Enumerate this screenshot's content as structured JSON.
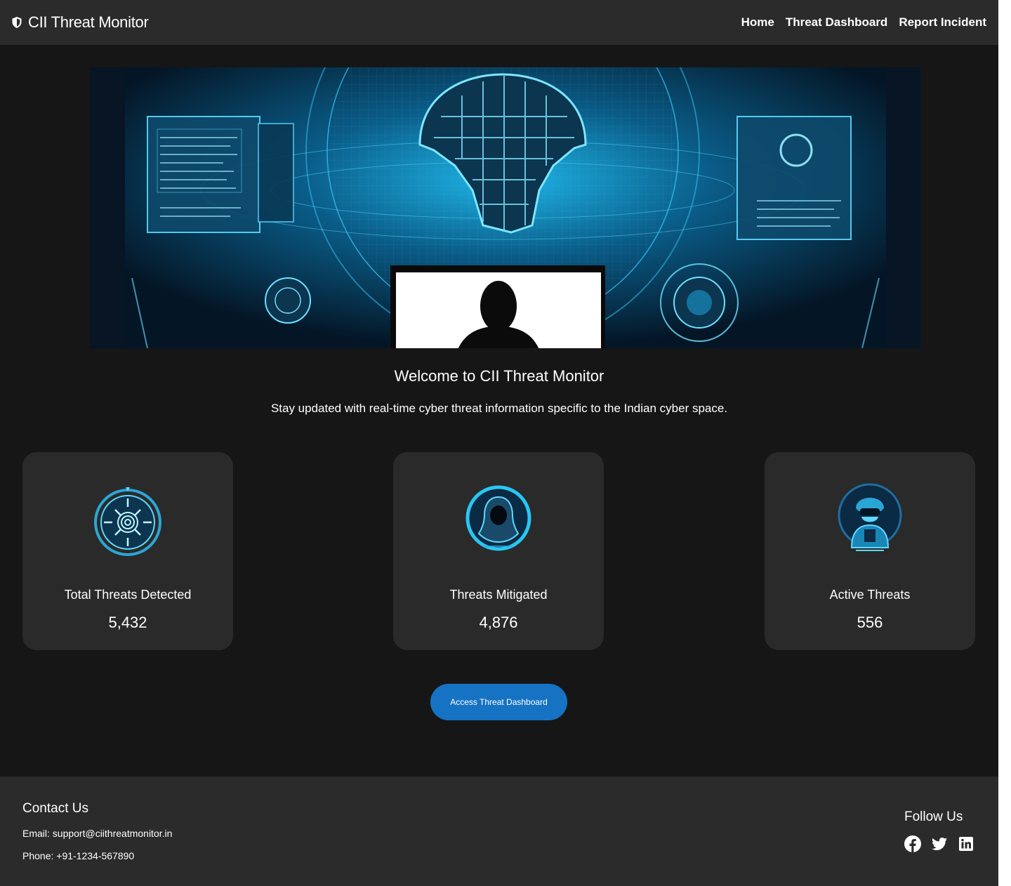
{
  "header": {
    "brand_title": "CII Threat Monitor",
    "brand_icon": "shield-icon",
    "nav": [
      "Home",
      "Threat Dashboard",
      "Report Incident"
    ]
  },
  "hero": {
    "image": "cyber-security-globe-illustration",
    "heading": "Welcome to CII Threat Monitor",
    "tagline": "Stay updated with real-time cyber threat information specific to the Indian cyber space."
  },
  "stats": [
    {
      "label": "Total Threats Detected",
      "value": "5,432",
      "icon": "radar-target-icon"
    },
    {
      "label": "Threats Mitigated",
      "value": "4,876",
      "icon": "hooded-hacker-icon"
    },
    {
      "label": "Active Threats",
      "value": "556",
      "icon": "armored-soldier-icon"
    }
  ],
  "cta": {
    "label": "Access Threat Dashboard"
  },
  "footer": {
    "contact_title": "Contact Us",
    "email": "Email: support@ciithreatmonitor.in",
    "phone": "Phone: +91-1234-567890",
    "follow_title": "Follow Us",
    "social_icons": [
      "facebook-icon",
      "twitter-icon",
      "linkedin-icon"
    ]
  },
  "colors": {
    "background": "#161616",
    "header_bg": "#2b2b2b",
    "card_bg": "#2a2a2a",
    "accent": "#1673c4",
    "icon_cyan": "#29c6f2"
  }
}
